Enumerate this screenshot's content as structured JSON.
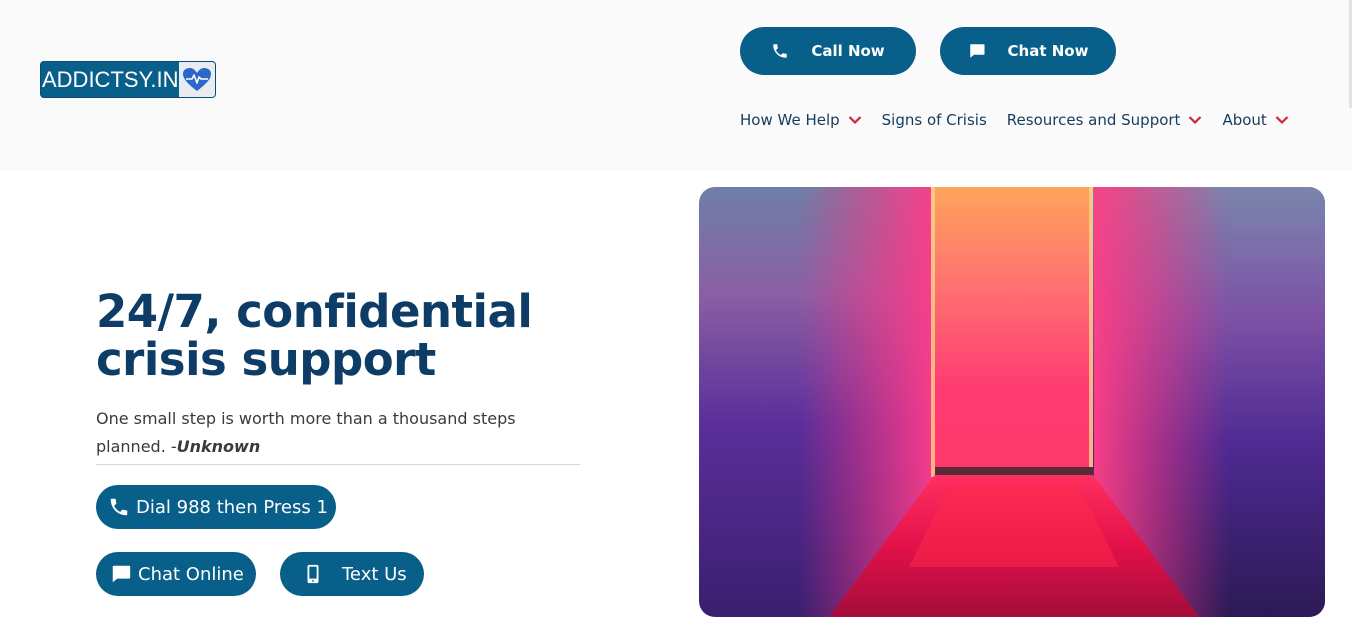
{
  "brand": {
    "logo_text": "ADDICTSY.IN",
    "logo_icon": "heart-pulse-icon"
  },
  "header": {
    "call_label": "Call Now",
    "chat_label": "Chat Now",
    "nav": [
      {
        "label": "How We Help",
        "has_dropdown": true
      },
      {
        "label": "Signs of Crisis",
        "has_dropdown": false
      },
      {
        "label": "Resources and Support",
        "has_dropdown": true
      },
      {
        "label": "About",
        "has_dropdown": true
      }
    ]
  },
  "hero": {
    "title": "24/7, confidential crisis support",
    "quote_text": "One small step is worth more than a thousand steps planned. -",
    "quote_author": "Unknown",
    "dial_label": "Dial 988 then Press 1",
    "chat_online_label": "Chat Online",
    "text_label": "Text Us"
  },
  "colors": {
    "brand_blue": "#085f8a",
    "heading": "#0d3d66",
    "nav_text": "#153c5e",
    "chevron": "#d1233f"
  }
}
